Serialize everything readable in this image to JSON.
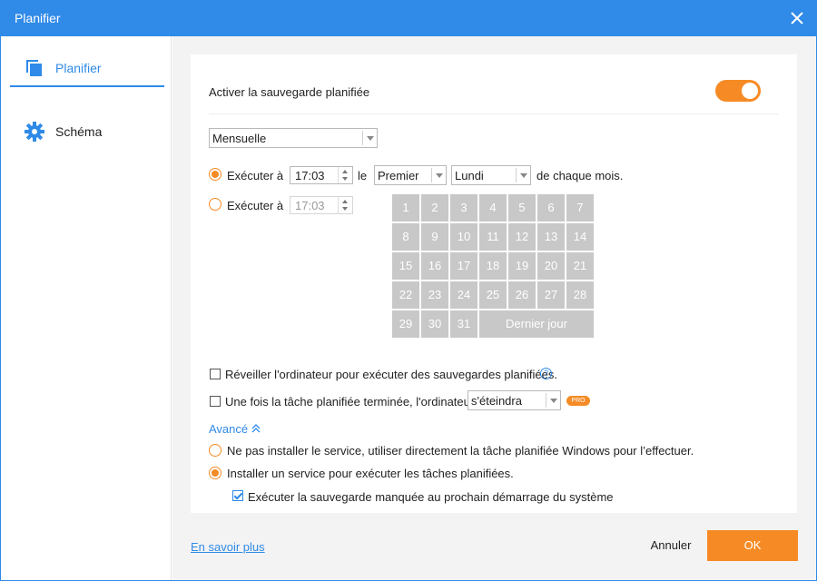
{
  "window": {
    "title": "Planifier"
  },
  "sidebar": {
    "items": [
      {
        "label": "Planifier"
      },
      {
        "label": "Schéma"
      }
    ]
  },
  "schedule": {
    "enable_label": "Activer la sauvegarde planifiée",
    "enabled": true,
    "frequency": "Mensuelle",
    "option1": {
      "prefix": "Exécuter à",
      "time": "17:03",
      "le": "le",
      "week": "Premier",
      "day": "Lundi",
      "suffix": "de chaque mois.",
      "selected": true
    },
    "option2": {
      "prefix": "Exécuter à",
      "time": "17:03",
      "selected": false
    },
    "calendar": {
      "days": [
        "1",
        "2",
        "3",
        "4",
        "5",
        "6",
        "7",
        "8",
        "9",
        "10",
        "11",
        "12",
        "13",
        "14",
        "15",
        "16",
        "17",
        "18",
        "19",
        "20",
        "21",
        "22",
        "23",
        "24",
        "25",
        "26",
        "27",
        "28",
        "29",
        "30",
        "31"
      ],
      "last_day": "Dernier jour"
    },
    "wake_label": "Réveiller l'ordinateur pour exécuter des sauvegardes planifiées.",
    "after_label": "Une fois la tâche planifiée terminée, l'ordinateur",
    "after_value": "s'éteindra",
    "pro_badge": "PRO",
    "advanced_label": "Avancé",
    "adv_option1": "Ne pas installer le service, utiliser directement la tâche planifiée Windows pour l’effectuer.",
    "adv_option2": "Installer un service pour exécuter les tâches planifiées.",
    "missed_label": "Exécuter la sauvegarde manquée au prochain démarrage du système"
  },
  "footer": {
    "learn_more": "En savoir plus",
    "cancel": "Annuler",
    "ok": "OK"
  },
  "colors": {
    "accent": "#2f8ae8",
    "orange": "#f68b25"
  }
}
